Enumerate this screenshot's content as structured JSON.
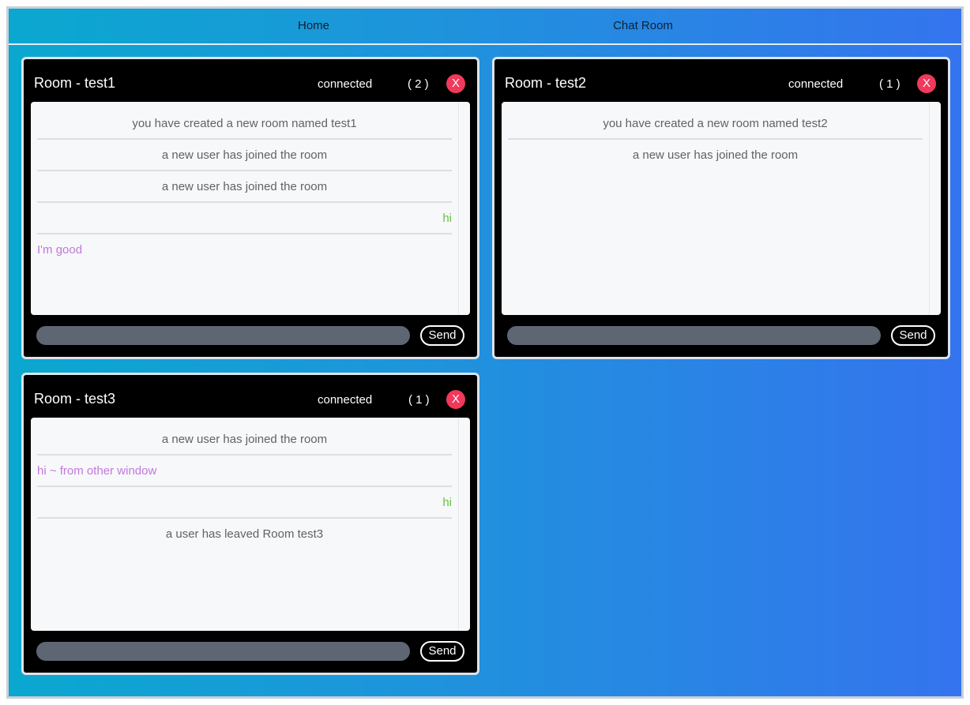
{
  "nav": {
    "home": "Home",
    "chat_room": "Chat Room"
  },
  "rooms": [
    {
      "title": "Room - test1",
      "status": "connected",
      "count": "( 2 )",
      "close": "X",
      "messages": [
        {
          "text": "you have created a new room named test1",
          "kind": "system"
        },
        {
          "text": "a new user has joined the room",
          "kind": "system"
        },
        {
          "text": "a new user has joined the room",
          "kind": "system"
        },
        {
          "text": "hi",
          "kind": "self"
        },
        {
          "text": "I'm good",
          "kind": "other"
        }
      ],
      "input_value": "",
      "send": "Send"
    },
    {
      "title": "Room - test2",
      "status": "connected",
      "count": "( 1 )",
      "close": "X",
      "messages": [
        {
          "text": "you have created a new room named test2",
          "kind": "system"
        },
        {
          "text": "a new user has joined the room",
          "kind": "system"
        }
      ],
      "input_value": "",
      "send": "Send"
    },
    {
      "title": "Room - test3",
      "status": "connected",
      "count": "( 1 )",
      "close": "X",
      "messages": [
        {
          "text": "a new user has joined the room",
          "kind": "system"
        },
        {
          "text": "hi ~ from other window",
          "kind": "other"
        },
        {
          "text": "hi",
          "kind": "self"
        },
        {
          "text": "a user has leaved Room test3",
          "kind": "system"
        }
      ],
      "input_value": "",
      "send": "Send"
    }
  ],
  "colors": {
    "gradient_start": "#0aa8cf",
    "gradient_end": "#3474ee",
    "close_button": "#f0395b",
    "self_message": "#67c23a",
    "other_message": "#c378dc",
    "system_message": "#606266"
  }
}
